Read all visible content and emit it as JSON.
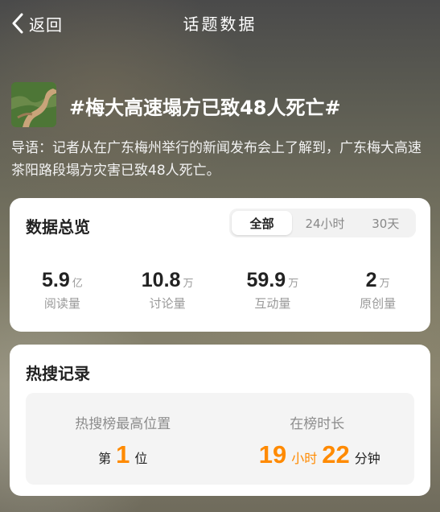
{
  "nav": {
    "back_label": "返回",
    "title": "话题数据"
  },
  "topic": {
    "title": "#梅大高速塌方已致48人死亡#",
    "intro": "导语：记者从在广东梅州举行的新闻发布会上了解到，广东梅大高速茶阳路段塌方灾害已致48人死亡。"
  },
  "overview": {
    "title": "数据总览",
    "tabs": [
      "全部",
      "24小时",
      "30天"
    ],
    "active_tab": "全部",
    "stats": [
      {
        "value": "5.9",
        "unit": "亿",
        "label": "阅读量"
      },
      {
        "value": "10.8",
        "unit": "万",
        "label": "讨论量"
      },
      {
        "value": "59.9",
        "unit": "万",
        "label": "互动量"
      },
      {
        "value": "2",
        "unit": "万",
        "label": "原创量"
      }
    ]
  },
  "hot": {
    "title": "热搜记录",
    "highest": {
      "label": "热搜榜最高位置",
      "prefix": "第",
      "value": "1",
      "suffix": "位"
    },
    "duration": {
      "label": "在榜时长",
      "hours": "19",
      "hours_unit": "小时",
      "minutes": "22",
      "minutes_unit": "分钟"
    }
  },
  "colors": {
    "accent": "#ff8a00",
    "card_bg": "#ffffff",
    "muted": "#999999"
  },
  "icons": {
    "back": "chevron-left-icon",
    "thumbnail": "topic-thumbnail"
  }
}
